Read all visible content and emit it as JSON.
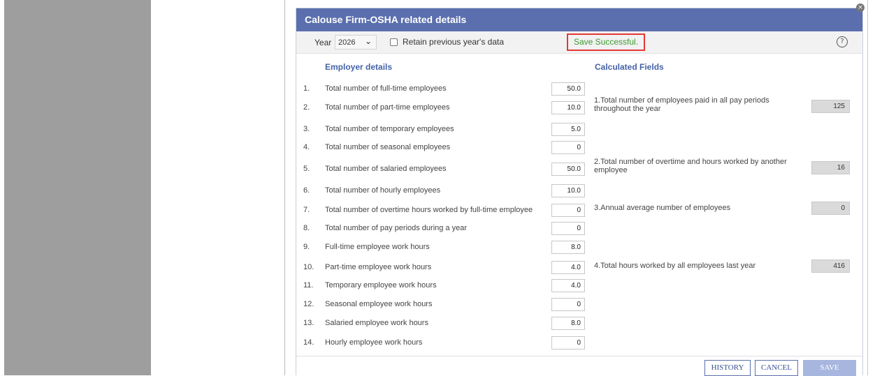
{
  "dialog": {
    "title": "Calouse Firm-OSHA related details",
    "close_glyph": "×"
  },
  "toolbar": {
    "year_label": "Year",
    "year_value": "2026",
    "retain_label": "Retain previous year's data",
    "save_message": "Save Successful.",
    "help_glyph": "?"
  },
  "employer": {
    "title": "Employer details",
    "rows": [
      {
        "num": "1.",
        "label": "Total number of full-time employees",
        "value": "50.0"
      },
      {
        "num": "2.",
        "label": "Total number of part-time employees",
        "value": "10.0"
      },
      {
        "num": "3.",
        "label": "Total number of temporary employees",
        "value": "5.0"
      },
      {
        "num": "4.",
        "label": "Total number of seasonal employees",
        "value": "0"
      },
      {
        "num": "5.",
        "label": "Total number of salaried employees",
        "value": "50.0"
      },
      {
        "num": "6.",
        "label": "Total number of hourly employees",
        "value": "10.0"
      },
      {
        "num": "7.",
        "label": "Total number of overtime hours worked by full-time employee",
        "value": "0"
      },
      {
        "num": "8.",
        "label": "Total number of pay periods during a year",
        "value": "0"
      },
      {
        "num": "9.",
        "label": "Full-time employee work hours",
        "value": "8.0"
      },
      {
        "num": "10.",
        "label": "Part-time employee work hours",
        "value": "4.0"
      },
      {
        "num": "11.",
        "label": "Temporary employee work hours",
        "value": "4.0"
      },
      {
        "num": "12.",
        "label": "Seasonal employee work hours",
        "value": "0"
      },
      {
        "num": "13.",
        "label": "Salaried employee work hours",
        "value": "8.0"
      },
      {
        "num": "14.",
        "label": "Hourly employee work hours",
        "value": "0"
      }
    ]
  },
  "calculated": {
    "title": "Calculated Fields",
    "items": [
      {
        "line1": "1.Total number of employees paid in all pay periods",
        "line2": "throughout the year",
        "value": "125"
      },
      {
        "line1": "2.Total number of overtime and hours worked by another",
        "line2": "employee",
        "value": "16"
      },
      {
        "line1": "3.Annual average number of employees",
        "line2": "",
        "value": "0"
      },
      {
        "line1": "4.Total hours worked by all employees last year",
        "line2": "",
        "value": "416"
      }
    ]
  },
  "buttons": {
    "history": "HISTORY",
    "cancel": "CANCEL",
    "save": "SAVE"
  },
  "colors": {
    "header_bg": "#5b6fae",
    "section_title": "#4462a8",
    "success_text": "#3b9a2e",
    "success_border": "#e53935"
  }
}
